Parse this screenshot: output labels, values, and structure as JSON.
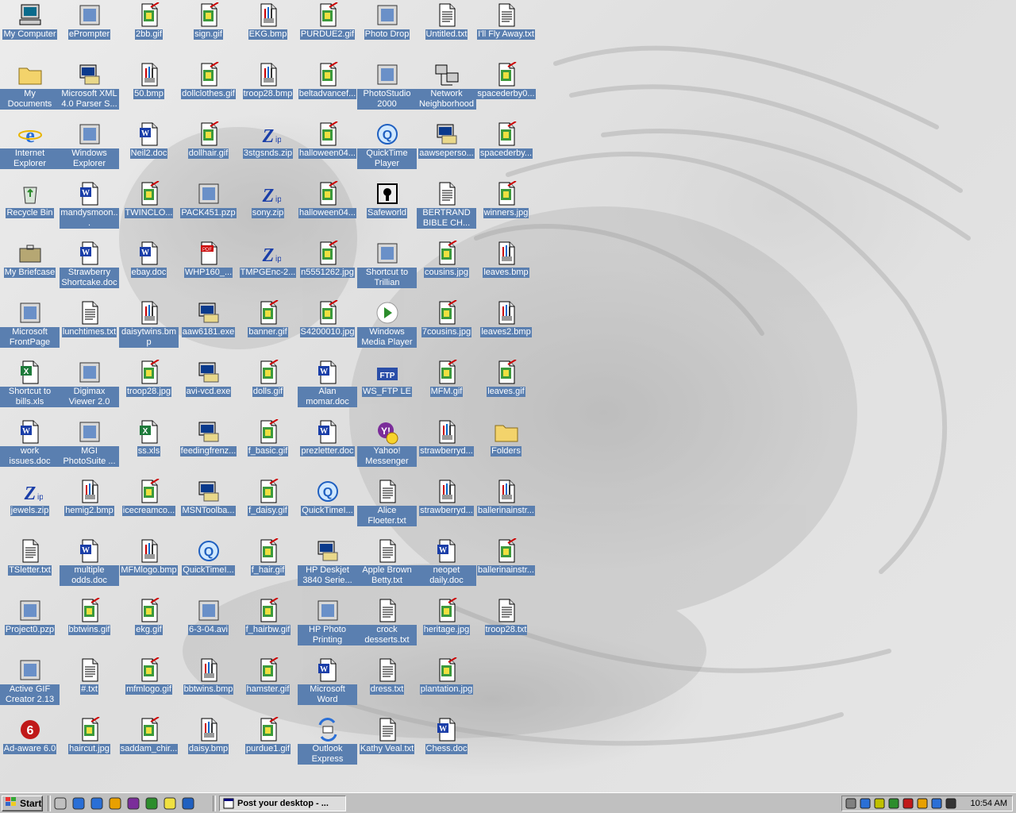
{
  "desktop": {
    "columns": [
      [
        "My Computer",
        "My Documents",
        "Internet Explorer",
        "Recycle Bin",
        "My Briefcase",
        "Microsoft FrontPage",
        "Shortcut to bills.xls",
        "work issues.doc",
        "jewels.zip",
        "TSletter.txt",
        "Project0.pzp",
        "Active GIF Creator 2.13",
        "Ad-aware 6.0"
      ],
      [
        "ePrompter",
        "Microsoft XML 4.0 Parser S...",
        "Windows Explorer",
        "mandysmoon...",
        "Strawberry Shortcake.doc",
        "lunchtimes.txt",
        "Digimax Viewer 2.0",
        "MGI PhotoSuite ...",
        "hemig2.bmp",
        "multiple odds.doc",
        "bbtwins.gif",
        "#.txt",
        "haircut.jpg"
      ],
      [
        "2bb.gif",
        "50.bmp",
        "Neil2.doc",
        "TWINCLO...",
        "ebay.doc",
        "daisytwins.bmp",
        "troop28.jpg",
        "ss.xls",
        "icecreamco...",
        "MFMlogo.bmp",
        "ekg.gif",
        "mfmlogo.gif",
        "saddam_chir..."
      ],
      [
        "sign.gif",
        "dollclothes.gif",
        "dollhair.gif",
        "PACK451.pzp",
        "WHP160_...",
        "aaw6181.exe",
        "avi-vcd.exe",
        "feedingfrenz...",
        "MSNToolba...",
        "QuickTimeI...",
        "6-3-04.avi",
        "bbtwins.bmp",
        "daisy.bmp"
      ],
      [
        "EKG.bmp",
        "troop28.bmp",
        "3stgsnds.zip",
        "sony.zip",
        "TMPGEnc-2...",
        "banner.gif",
        "dolls.gif",
        "f_basic.gif",
        "f_daisy.gif",
        "f_hair.gif",
        "f_hairbw.gif",
        "hamster.gif",
        "purdue1.gif"
      ],
      [
        "PURDUE2.gif",
        "beltadvancef...",
        "halloween04...",
        "halloween04...",
        "n5551262.jpg",
        "S4200010.jpg",
        "Alan momar.doc",
        "prezletter.doc",
        "QuickTimeI...",
        "HP Deskjet 3840 Serie...",
        "HP Photo Printing",
        "Microsoft Word",
        "Outlook Express"
      ],
      [
        "Photo Drop",
        "PhotoStudio 2000",
        "QuickTime Player",
        "Safeworld",
        "Shortcut to Trillian",
        "Windows Media Player",
        "WS_FTP LE",
        "Yahoo! Messenger",
        "Alice Floeter.txt",
        "Apple Brown Betty.txt",
        "crock desserts.txt",
        "dress.txt",
        "Kathy Veal.txt"
      ],
      [
        "Untitled.txt",
        "Network Neighborhood",
        "aawseperso...",
        "BERTRAND BIBLE CH...",
        "cousins.jpg",
        "7cousins.jpg",
        "MFM.gif",
        "strawberryd...",
        "strawberryd...",
        "neopet daily.doc",
        "heritage.jpg",
        "plantation.jpg",
        "Chess.doc"
      ],
      [
        "I'll Fly Away.txt",
        "spacederby0...",
        "spacederby...",
        "winners.jpg",
        "leaves.bmp",
        "leaves2.bmp",
        "leaves.gif",
        "Folders",
        "ballerinainstr...",
        "ballerinainstr...",
        "troop28.txt"
      ]
    ],
    "icon_types": [
      [
        "computer",
        "folder",
        "ie",
        "recycle",
        "briefcase",
        "frontpage",
        "excel",
        "word",
        "zip",
        "txt",
        "pzp",
        "gifcreator",
        "adaware"
      ],
      [
        "eprompter",
        "setup",
        "explorer",
        "word",
        "word",
        "txt",
        "digimax",
        "mgi",
        "bmp",
        "word",
        "gif",
        "txt",
        "gif"
      ],
      [
        "gif",
        "bmp",
        "word",
        "gif",
        "word",
        "bmp",
        "gif",
        "excel",
        "gif",
        "bmp",
        "gif",
        "gif",
        "gif"
      ],
      [
        "gif",
        "gif",
        "gif",
        "pzp",
        "pdf",
        "exe",
        "exe",
        "setup",
        "exe",
        "quicktime",
        "avi",
        "bmp",
        "bmp"
      ],
      [
        "bmp",
        "bmp",
        "zip",
        "zip",
        "zip",
        "gif",
        "gif",
        "gif",
        "gif",
        "gif",
        "gif",
        "gif",
        "gif"
      ],
      [
        "gif",
        "gif",
        "gif",
        "gif",
        "gif",
        "gif",
        "word",
        "word",
        "quicktime",
        "setup",
        "hpphoto",
        "msword",
        "outlook"
      ],
      [
        "photodrop",
        "photostudio",
        "quicktime",
        "safeworld",
        "trillian",
        "wmp",
        "wsftp",
        "yahoo",
        "txt",
        "txt",
        "txt",
        "txt",
        "txt"
      ],
      [
        "txt",
        "network",
        "exe",
        "txt",
        "gif",
        "gif",
        "gif",
        "bmp",
        "bmp",
        "word",
        "gif",
        "gif",
        "word"
      ],
      [
        "txt",
        "gif",
        "gif",
        "gif",
        "bmp",
        "bmp",
        "gif",
        "folder",
        "bmp",
        "gif",
        "txt"
      ]
    ]
  },
  "taskbar": {
    "start_label": "Start",
    "quick_launch": [
      "show-desktop-icon",
      "internet-explorer-icon",
      "outlook-express-icon",
      "aim-icon",
      "yahoo-messenger-icon",
      "media-player-icon",
      "search-icon",
      "quicktime-icon"
    ],
    "task_label": "Post your desktop - ...",
    "tray_icons": [
      "volume-icon",
      "network-icon",
      "scanner-icon",
      "connection-icon",
      "adobe-icon",
      "messenger-icon",
      "ie-tray-icon",
      "safeworld-tray-icon"
    ],
    "clock": "10:54 AM"
  },
  "colors": {
    "label_highlight": "#5a7fb0",
    "taskbar_gray": "#c0c0c0"
  }
}
